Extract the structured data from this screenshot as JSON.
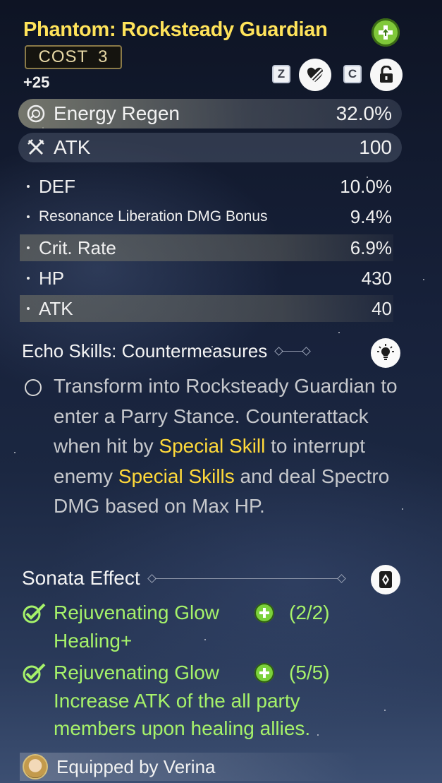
{
  "header": {
    "title": "Phantom: Rocksteady Guardian",
    "cost_label": "COST",
    "cost_value": "3",
    "level": "+25",
    "key_lock_discard": "Z",
    "key_lock": "C"
  },
  "main_stats": [
    {
      "label": "Energy Regen",
      "value": "32.0%",
      "icon": "energy-regen-icon"
    },
    {
      "label": "ATK",
      "value": "100",
      "icon": "atk-swords-icon"
    }
  ],
  "sub_stats": [
    {
      "label": "DEF",
      "value": "10.0%"
    },
    {
      "label": "Resonance Liberation DMG Bonus",
      "value": "9.4%"
    },
    {
      "label": "Crit. Rate",
      "value": "6.9%"
    },
    {
      "label": "HP",
      "value": "430"
    },
    {
      "label": "ATK",
      "value": "40"
    }
  ],
  "echo_skill": {
    "heading": "Echo Skills: Countermeasures",
    "text_1": "Transform into Rocksteady Guardian to enter a Parry Stance. Counterattack when hit by ",
    "highlight_1": "Special Skill",
    "text_2": " to interrupt enemy ",
    "highlight_2": "Special Skills",
    "text_3": " and deal Spectro DMG based on Max HP."
  },
  "sonata": {
    "heading": "Sonata Effect",
    "effects": [
      {
        "name": "Rejuvenating Glow",
        "count": "(2/2)",
        "desc": "Healing+"
      },
      {
        "name": "Rejuvenating Glow",
        "count": "(5/5)",
        "desc": "Increase ATK of the all party members upon healing allies."
      }
    ]
  },
  "equipped": "Equipped by Verina",
  "colors": {
    "title": "#ffe35a",
    "highlight": "#ffd93a",
    "sonata_green": "#a6f26a"
  }
}
